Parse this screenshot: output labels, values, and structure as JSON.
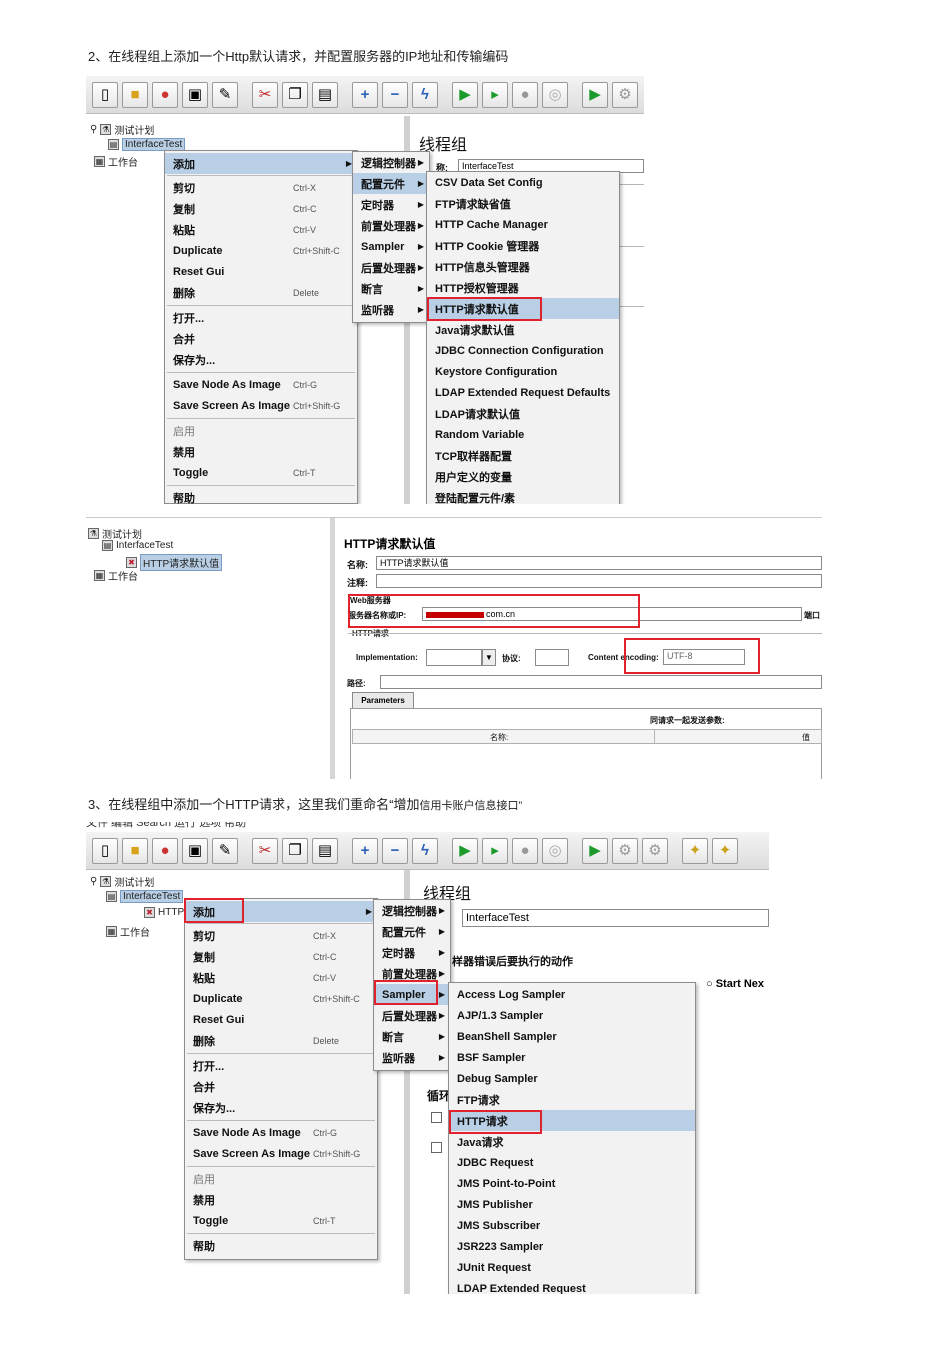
{
  "heading1": "2、在线程组上添加一个Http默认请求，并配置服务器的IP地址和传输编码",
  "heading2_prefix": "3、在线程组中添加一个HTTP请求，这里我们重命名“增加",
  "heading2_suffix": "信用卡账户信息接口”",
  "tree": {
    "test_plan": "测试计划",
    "thread_group": "InterfaceTest",
    "workbench": "工作台",
    "http_defaults_node": "HTTP请求默认值",
    "http_short": "HTTP"
  },
  "context_menu": {
    "items": [
      {
        "label": "添加",
        "shortcut": ""
      },
      {
        "label": "剪切",
        "shortcut": "Ctrl-X"
      },
      {
        "label": "复制",
        "shortcut": "Ctrl-C"
      },
      {
        "label": "粘贴",
        "shortcut": "Ctrl-V"
      },
      {
        "label": "Duplicate",
        "shortcut": "Ctrl+Shift-C"
      },
      {
        "label": "Reset Gui",
        "shortcut": ""
      },
      {
        "label": "删除",
        "shortcut": "Delete"
      },
      {
        "label": "打开...",
        "shortcut": ""
      },
      {
        "label": "合并",
        "shortcut": ""
      },
      {
        "label": "保存为...",
        "shortcut": ""
      },
      {
        "label": "Save Node As Image",
        "shortcut": "Ctrl-G"
      },
      {
        "label": "Save Screen As Image",
        "shortcut": "Ctrl+Shift-G"
      },
      {
        "label": "启用",
        "shortcut": ""
      },
      {
        "label": "禁用",
        "shortcut": ""
      },
      {
        "label": "Toggle",
        "shortcut": "Ctrl-T"
      },
      {
        "label": "帮助",
        "shortcut": ""
      }
    ]
  },
  "add_submenu": [
    "逻辑控制器",
    "配置元件",
    "定时器",
    "前置处理器",
    "Sampler",
    "后置处理器",
    "断言",
    "监听器"
  ],
  "config_submenu": [
    "CSV Data Set Config",
    "FTP请求缺省值",
    "HTTP Cache Manager",
    "HTTP Cookie 管理器",
    "HTTP信息头管理器",
    "HTTP授权管理器",
    "HTTP请求默认值",
    "Java请求默认值",
    "JDBC Connection Configuration",
    "Keystore Configuration",
    "LDAP Extended Request Defaults",
    "LDAP请求默认值",
    "Random Variable",
    "TCP取样器配置",
    "用户定义的变量",
    "登陆配置元件/素"
  ],
  "sampler_submenu": [
    "Access Log Sampler",
    "AJP/1.3 Sampler",
    "BeanShell Sampler",
    "BSF Sampler",
    "Debug Sampler",
    "FTP请求",
    "HTTP请求",
    "Java请求",
    "JDBC Request",
    "JMS Point-to-Point",
    "JMS Publisher",
    "JMS Subscriber",
    "JSR223 Sampler",
    "JUnit Request",
    "LDAP Extended Request"
  ],
  "thread_group_panel": {
    "title": "线程组",
    "name_label": "称:",
    "name_value": "InterfaceTest",
    "on_error_label": "样器错误后要执行的动作",
    "start_next": "Start Nex",
    "loop_label": "循环"
  },
  "http_defaults_panel": {
    "title": "HTTP请求默认值",
    "name_label": "名称:",
    "name_value": "HTTP请求默认值",
    "comment_label": "注释:",
    "web_server_label": "Web服务器",
    "server_label": "服务器名称或IP:",
    "server_value": "com.cn",
    "port_label": "端口",
    "http_request_label": "HTTP请求",
    "implementation_label": "Implementation:",
    "protocol_label": "协议:",
    "encoding_label": "Content encoding:",
    "encoding_value": "UTF-8",
    "path_label": "路径:",
    "params_tab": "Parameters",
    "params_caption": "同请求一起发送参数:",
    "col_name": "名称:",
    "col_value": "值"
  },
  "menubar_partial": "文件  编辑  Search  运行  选项  帮助"
}
